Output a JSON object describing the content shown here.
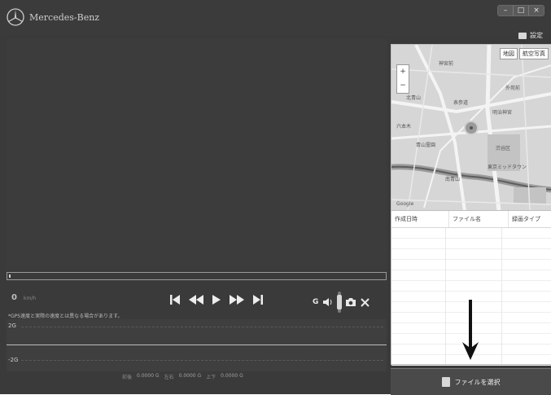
{
  "app": {
    "brand_name": "Mercedes-Benz",
    "window_controls": [
      "–",
      "□",
      "×"
    ]
  },
  "header": {
    "settings_label": "設定"
  },
  "map": {
    "tabs": [
      "地図",
      "航空写真"
    ],
    "zoom_in": "+",
    "zoom_out": "−",
    "labels": [
      "神宮前",
      "外苑前",
      "表参道",
      "北青山",
      "青山霊園",
      "六本木",
      "明治神宮",
      "渋谷区",
      "南青山",
      "東京ミッドタウン",
      "Google"
    ]
  },
  "file_list": {
    "columns": [
      "作成日時",
      "ファイル名",
      "録画タイプ"
    ],
    "select_button": "ファイルを選択"
  },
  "player": {
    "speed_value": "0",
    "speed_unit": "km/h",
    "gsensor_label": "G",
    "note": "*GPS速度と実際の速度とは異なる場合があります。"
  },
  "graph": {
    "top_label": "2G",
    "bottom_label": "-2G",
    "readout": [
      {
        "label": "前後",
        "value": "0.0000 G"
      },
      {
        "label": "左右",
        "value": "0.0000 G"
      },
      {
        "label": "上下",
        "value": "0.0000 G"
      }
    ]
  },
  "colors": {
    "background": "#3a3a3a",
    "panel": "#ffffff",
    "button_bar": "#4a4a4a"
  }
}
